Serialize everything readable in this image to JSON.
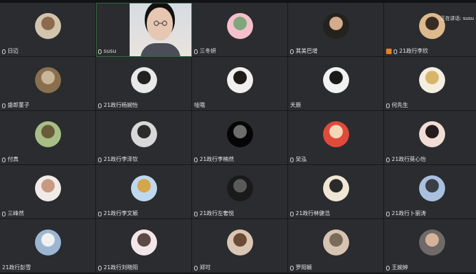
{
  "meeting": {
    "speaking_label": "正在讲话: susu",
    "participants": [
      {
        "name": "日迈",
        "avatar": "#d3c5ad",
        "avatar2": "#8c6a4e",
        "mic": true
      },
      {
        "name": "susu",
        "video": true,
        "mic": true,
        "speaking": true
      },
      {
        "name": "三冬妍",
        "avatar": "#f4bfca",
        "avatar2": "#7fa77b",
        "mic": true
      },
      {
        "name": "其美巴增",
        "avatar": "#23221f",
        "avatar2": "#d4ab8c",
        "mic": true
      },
      {
        "name": "21政行李欣",
        "avatar": "#ddb98d",
        "avatar2": "#3a2b22",
        "mic": true,
        "host": true
      },
      {
        "name": "盛郎董子",
        "avatar": "#8a6f4f",
        "avatar2": "#c9b59a",
        "mic": true
      },
      {
        "name": "21政行杨婉怡",
        "avatar": "#e9e9e9",
        "avatar2": "#222222",
        "mic": true
      },
      {
        "name": "哇哦",
        "avatar": "#f2f0ee",
        "avatar2": "#1f1b19",
        "mic": false
      },
      {
        "name": "天辰",
        "avatar": "#f2f2f2",
        "avatar2": "#1a1a1a",
        "mic": false
      },
      {
        "name": "何先生",
        "avatar": "#f3eee0",
        "avatar2": "#d9b56a",
        "mic": true
      },
      {
        "name": "付真",
        "avatar": "#a7bf86",
        "avatar2": "#6a5b3b",
        "mic": true
      },
      {
        "name": "21政行李泽钦",
        "avatar": "#d8d8d8",
        "avatar2": "#2b2b2b",
        "mic": true
      },
      {
        "name": "21政行李楠然",
        "avatar": "#050505",
        "avatar2": "#6d6d6d",
        "mic": true
      },
      {
        "name": "吴泓",
        "avatar": "#e04a3b",
        "avatar2": "#f4d7b8",
        "mic": true
      },
      {
        "name": "21政行莫心怡",
        "avatar": "#f1ddd6",
        "avatar2": "#241c1c",
        "mic": true
      },
      {
        "name": "三峰然",
        "avatar": "#f1ebe8",
        "avatar2": "#c99a82",
        "mic": true
      },
      {
        "name": "21政行李文颖",
        "avatar": "#bfd8ef",
        "avatar2": "#d6a64a",
        "mic": true
      },
      {
        "name": "21政行左奢悦",
        "avatar": "#1a1a1a",
        "avatar2": "#5a5a5a",
        "mic": true
      },
      {
        "name": "21政行林健浩",
        "avatar": "#f0e6d4",
        "avatar2": "#2a2a2a",
        "mic": true
      },
      {
        "name": "21政行卜丽涛",
        "avatar": "#a9c0df",
        "avatar2": "#3a3f46",
        "mic": true
      },
      {
        "name": "21政行彭雪",
        "avatar": "#9cb6d2",
        "avatar2": "#f0f0f0",
        "mic": false
      },
      {
        "name": "21政行刘晓阳",
        "avatar": "#f3e6ea",
        "avatar2": "#5b4a44",
        "mic": true
      },
      {
        "name": "郑可",
        "avatar": "#d9c6b5",
        "avatar2": "#6b4b36",
        "mic": true
      },
      {
        "name": "罗阳颖",
        "avatar": "#d6c3b2",
        "avatar2": "#7a6a5a",
        "mic": true
      },
      {
        "name": "王婉婷",
        "avatar": "#6f6a69",
        "avatar2": "#d5b39a",
        "mic": true
      }
    ]
  }
}
